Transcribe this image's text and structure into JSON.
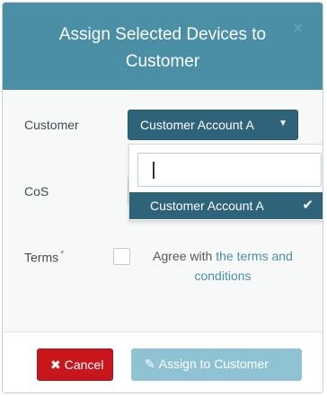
{
  "modal": {
    "title": "Assign Selected Devices to Customer",
    "close_glyph": "×"
  },
  "form": {
    "customer_label": "Customer",
    "customer_value": "Customer Account A",
    "cos_label": "CoS",
    "terms_label": "Terms",
    "terms_required": "*",
    "agree_prefix": "Agree with ",
    "agree_link": "the terms and conditions"
  },
  "dropdown": {
    "search_value": "",
    "options": [
      {
        "label": "Customer Account A",
        "selected": true
      }
    ]
  },
  "footer": {
    "cancel_label": "Cancel",
    "assign_label": "Assign to Customer"
  },
  "icons": {
    "caret": "caret-down-icon",
    "check": "check-icon",
    "cancel": "times-icon",
    "assign": "edit-icon"
  },
  "colors": {
    "header_bg": "#4b8fa6",
    "select_bg": "#2f6379",
    "cancel_bg": "#c8171c",
    "assign_bg": "#8fc3d3",
    "link": "#4b8fa6"
  }
}
